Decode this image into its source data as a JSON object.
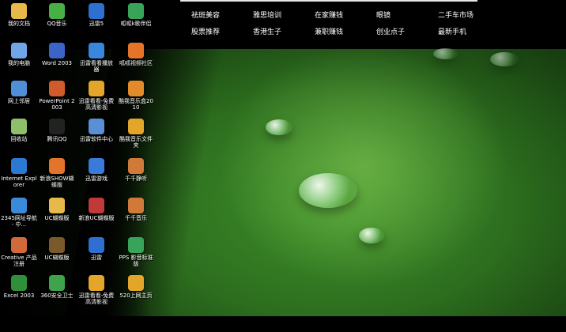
{
  "top_links": [
    [
      "祛斑美容",
      "雅思培训",
      "在家赚钱",
      "眼镜",
      "二手车市场"
    ],
    [
      "股票推荐",
      "香港生子",
      "兼职赚钱",
      "创业点子",
      "最新手机"
    ]
  ],
  "desktop_icons": [
    [
      {
        "label": "我的文档",
        "icon": "folder-icon",
        "color": "#e7b84a"
      },
      {
        "label": "我的电脑",
        "icon": "computer-icon",
        "color": "#6fa6e8"
      },
      {
        "label": "网上邻居",
        "icon": "network-icon",
        "color": "#4f8fd8"
      },
      {
        "label": "回收站",
        "icon": "recycle-bin-icon",
        "color": "#8fbf6a"
      },
      {
        "label": "Internet Explorer",
        "icon": "ie-icon",
        "color": "#2b79d2"
      },
      {
        "label": "2345网址导航 - 中...",
        "icon": "browser-icon",
        "color": "#3a8ad9"
      },
      {
        "label": "Creative 产品注册",
        "icon": "pen-icon",
        "color": "#d06a3a"
      },
      {
        "label": "Excel 2003",
        "icon": "excel-icon",
        "color": "#2f8f3a"
      }
    ],
    [
      {
        "label": "QQ音乐",
        "icon": "qq-music-icon",
        "color": "#49b046"
      },
      {
        "label": "Word 2003",
        "icon": "word-icon",
        "color": "#3a64c6"
      },
      {
        "label": "PowerPoint 2003",
        "icon": "powerpoint-icon",
        "color": "#d15b2a"
      },
      {
        "label": "腾讯QQ",
        "icon": "qq-icon",
        "color": "#222222"
      },
      {
        "label": "新浪SHOW蝴蝶版",
        "icon": "sina-show-icon",
        "color": "#e3742a"
      },
      {
        "label": "UC蝴蝶版",
        "icon": "folder-icon",
        "color": "#e7b84a"
      },
      {
        "label": "UC蝴蝶版",
        "icon": "uc-icon",
        "color": "#7a5a2a"
      },
      {
        "label": "360安全卫士",
        "icon": "shield-icon",
        "color": "#3ea34a"
      }
    ],
    [
      {
        "label": "迅雷5",
        "icon": "thunder-icon",
        "color": "#2e6fd0"
      },
      {
        "label": "迅雷看看播放器",
        "icon": "thunder-player-icon",
        "color": "#3a86dc"
      },
      {
        "label": "迅雷看看-免费高清影视",
        "icon": "thunder-video-icon",
        "color": "#e3a52a"
      },
      {
        "label": "迅雷软件中心",
        "icon": "software-center-icon",
        "color": "#5a8fd6"
      },
      {
        "label": "迅雷游戏",
        "icon": "game-icon",
        "color": "#3a7ad8"
      },
      {
        "label": "新浪UC蝴蝶版",
        "icon": "uc-app-icon",
        "color": "#c03a3a"
      },
      {
        "label": "迅雷",
        "icon": "thunder-icon",
        "color": "#2e6fd0"
      },
      {
        "label": "迅雷看看-免费高清影视",
        "icon": "thunder-video-icon",
        "color": "#e3a52a"
      }
    ],
    [
      {
        "label": "呱呱k歌伴侣",
        "icon": "karaoke-icon",
        "color": "#3aa35a"
      },
      {
        "label": "呱呱视频社区",
        "icon": "video-community-icon",
        "color": "#e3742a"
      },
      {
        "label": "酷我音乐盒2010",
        "icon": "music-box-icon",
        "color": "#e38a2a"
      },
      {
        "label": "酷我音乐文件夹",
        "icon": "music-folder-icon",
        "color": "#e3a52a"
      },
      {
        "label": "千千静听",
        "icon": "player-icon",
        "color": "#d07a3a"
      },
      {
        "label": "千千音乐",
        "icon": "music-icon",
        "color": "#d07a3a"
      },
      {
        "label": "PPS 影音标准版",
        "icon": "pps-icon",
        "color": "#3aa35a"
      },
      {
        "label": "520上网主页",
        "icon": "homepage-icon",
        "color": "#e3a52a"
      }
    ]
  ]
}
